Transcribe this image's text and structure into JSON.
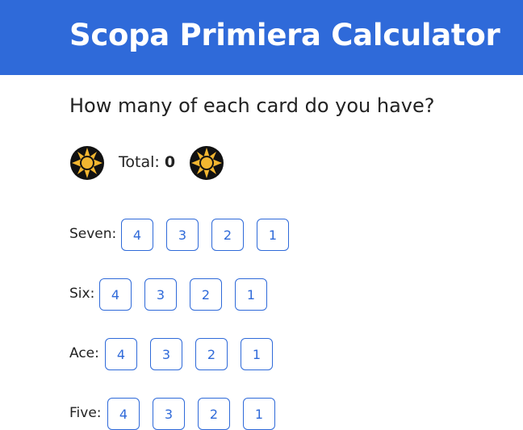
{
  "header": {
    "title": "Scopa Primiera Calculator",
    "bg_color": "#2f6ad9"
  },
  "question": "How many of each card do you have?",
  "total": {
    "label": "Total:",
    "value": "0",
    "icon": "sun-coin-icon"
  },
  "cards": [
    {
      "label": "Seven:",
      "options": [
        "4",
        "3",
        "2",
        "1"
      ]
    },
    {
      "label": "Six:",
      "options": [
        "4",
        "3",
        "2",
        "1"
      ]
    },
    {
      "label": "Ace:",
      "options": [
        "4",
        "3",
        "2",
        "1"
      ]
    },
    {
      "label": "Five:",
      "options": [
        "4",
        "3",
        "2",
        "1"
      ]
    }
  ]
}
